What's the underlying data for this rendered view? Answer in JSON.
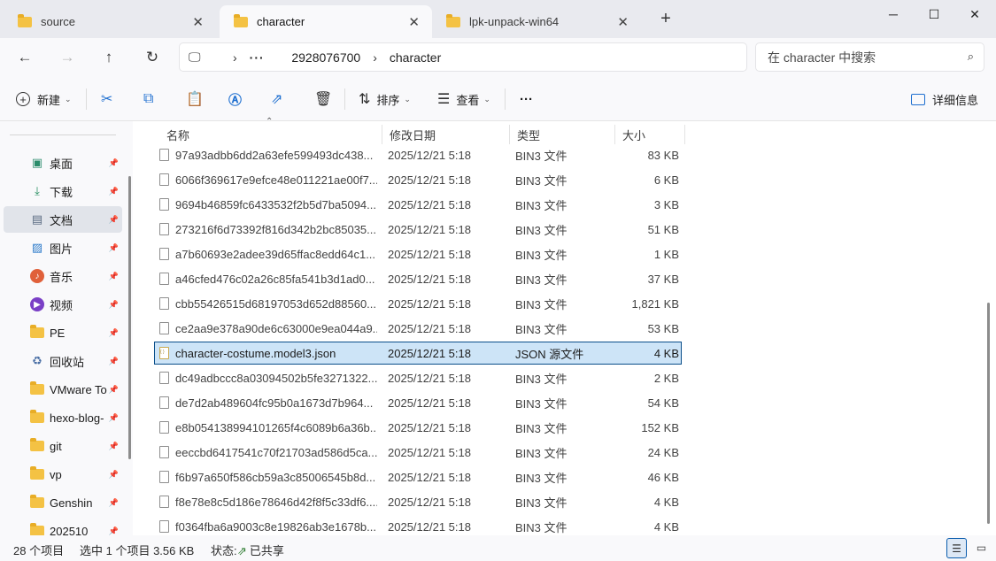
{
  "tabs": [
    {
      "label": "source",
      "icon": "folder-icon"
    },
    {
      "label": "character",
      "icon": "folder-icon",
      "active": true
    },
    {
      "label": "lpk-unpack-win64",
      "icon": "folder-icon"
    }
  ],
  "window_controls": {
    "minimize": "─",
    "maximize": "☐",
    "close": "✕"
  },
  "nav": {
    "back": "←",
    "forward": "→",
    "up": "↑",
    "refresh": "↻"
  },
  "address": {
    "segments": [
      "2928076700",
      "character"
    ],
    "overflow": "···"
  },
  "search": {
    "placeholder": "在 character 中搜索"
  },
  "toolbar": {
    "new_label": "新建",
    "sort_label": "排序",
    "view_label": "查看",
    "more_label": "···",
    "details_label": "详细信息"
  },
  "sidebar": {
    "items": [
      {
        "label": "桌面",
        "icon": "desktop-icon"
      },
      {
        "label": "下载",
        "icon": "download-icon"
      },
      {
        "label": "文档",
        "icon": "documents-icon",
        "selected": true
      },
      {
        "label": "图片",
        "icon": "pictures-icon"
      },
      {
        "label": "音乐",
        "icon": "music-icon"
      },
      {
        "label": "视频",
        "icon": "videos-icon"
      },
      {
        "label": "PE",
        "icon": "folder-icon"
      },
      {
        "label": "回收站",
        "icon": "recycle-bin-icon"
      },
      {
        "label": "VMware To",
        "icon": "folder-icon"
      },
      {
        "label": "hexo-blog-",
        "icon": "folder-icon"
      },
      {
        "label": "git",
        "icon": "folder-icon"
      },
      {
        "label": "vp",
        "icon": "folder-icon"
      },
      {
        "label": "Genshin",
        "icon": "folder-icon"
      },
      {
        "label": "202510",
        "icon": "folder-icon"
      }
    ]
  },
  "columns": {
    "name": "名称",
    "date": "修改日期",
    "type": "类型",
    "size": "大小"
  },
  "files": [
    {
      "name": "97a93adbb6dd2a63efe599493dc438...",
      "date": "2025/12/21 5:18",
      "type": "BIN3 文件",
      "size": "83 KB"
    },
    {
      "name": "6066f369617e9efce48e011221ae00f7....",
      "date": "2025/12/21 5:18",
      "type": "BIN3 文件",
      "size": "6 KB"
    },
    {
      "name": "9694b46859fc6433532f2b5d7ba5094...",
      "date": "2025/12/21 5:18",
      "type": "BIN3 文件",
      "size": "3 KB"
    },
    {
      "name": "273216f6d73392f816d342b2bc85035...",
      "date": "2025/12/21 5:18",
      "type": "BIN3 文件",
      "size": "51 KB"
    },
    {
      "name": "a7b60693e2adee39d65ffac8edd64c1...",
      "date": "2025/12/21 5:18",
      "type": "BIN3 文件",
      "size": "1 KB"
    },
    {
      "name": "a46cfed476c02a26c85fa541b3d1ad0...",
      "date": "2025/12/21 5:18",
      "type": "BIN3 文件",
      "size": "37 KB"
    },
    {
      "name": "cbb55426515d68197053d652d88560...",
      "date": "2025/12/21 5:18",
      "type": "BIN3 文件",
      "size": "1,821 KB"
    },
    {
      "name": "ce2aa9e378a90de6c63000e9ea044a9...",
      "date": "2025/12/21 5:18",
      "type": "BIN3 文件",
      "size": "53 KB"
    },
    {
      "name": "character-costume.model3.json",
      "date": "2025/12/21 5:18",
      "type": "JSON 源文件",
      "size": "4 KB",
      "selected": true
    },
    {
      "name": "dc49adbccc8a03094502b5fe3271322...",
      "date": "2025/12/21 5:18",
      "type": "BIN3 文件",
      "size": "2 KB"
    },
    {
      "name": "de7d2ab489604fc95b0a1673d7b964...",
      "date": "2025/12/21 5:18",
      "type": "BIN3 文件",
      "size": "54 KB"
    },
    {
      "name": "e8b054138994101265f4c6089b6a36b...",
      "date": "2025/12/21 5:18",
      "type": "BIN3 文件",
      "size": "152 KB"
    },
    {
      "name": "eeccbd6417541c70f21703ad586d5ca...",
      "date": "2025/12/21 5:18",
      "type": "BIN3 文件",
      "size": "24 KB"
    },
    {
      "name": "f6b97a650f586cb59a3c85006545b8d...",
      "date": "2025/12/21 5:18",
      "type": "BIN3 文件",
      "size": "46 KB"
    },
    {
      "name": "f8e78e8c5d186e78646d42f8f5c33df6....",
      "date": "2025/12/21 5:18",
      "type": "BIN3 文件",
      "size": "4 KB"
    },
    {
      "name": "f0364fba6a9003c8e19826ab3e1678b...",
      "date": "2025/12/21 5:18",
      "type": "BIN3 文件",
      "size": "4 KB"
    }
  ],
  "status": {
    "item_count": "28 个项目",
    "selection": "选中 1 个项目  3.56 KB",
    "state_label": "状态:",
    "state_value": "已共享"
  }
}
